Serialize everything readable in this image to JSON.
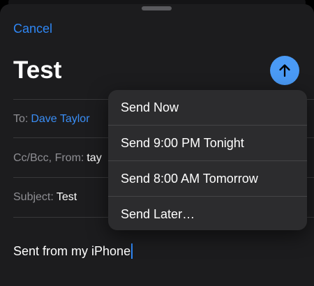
{
  "compose": {
    "cancel_label": "Cancel",
    "title": "Test",
    "send_icon": "arrow-up-icon",
    "to_label": "To:",
    "to_value": "Dave Taylor",
    "ccbcc_label": "Cc/Bcc, From:",
    "ccbcc_value": "tay",
    "subject_label": "Subject:",
    "subject_value": "Test",
    "body": "Sent from my iPhone"
  },
  "send_menu": {
    "items": [
      {
        "label": "Send Now"
      },
      {
        "label": "Send 9:00 PM Tonight"
      },
      {
        "label": "Send 8:00 AM Tomorrow"
      },
      {
        "label": "Send Later…"
      }
    ]
  },
  "colors": {
    "accent": "#2f87f5",
    "send_button": "#4a9af5",
    "sheet_background": "#1c1c1e",
    "menu_background": "#2c2c2e"
  }
}
